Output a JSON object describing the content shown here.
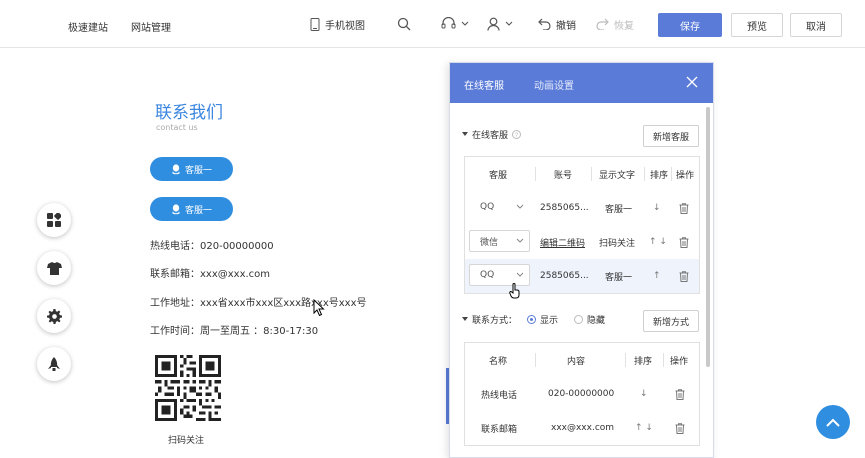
{
  "toolbar": {
    "nav_fast_site": "极速建站",
    "nav_site_manage": "网站管理",
    "mobile_view": "手机视图",
    "undo": "撤销",
    "redo": "恢复",
    "save": "保存",
    "preview": "预览",
    "cancel": "取消"
  },
  "page": {
    "section_title": "联系我们",
    "section_subtitle": "contact us",
    "qq_buttons": [
      "客服一",
      "客服一"
    ],
    "hotline": "热线电话：020-00000000",
    "email": "联系邮箱：xxx@xxx.com",
    "address": "工作地址：xxx省xxx市xxx区xxx路xxx号xxx号",
    "hours": "工作时间：周一至周五 ：8:30-17:30",
    "qr_caption": "扫码关注"
  },
  "panel": {
    "tab_service": "在线客服",
    "tab_animation": "动画设置",
    "group_service": "在线客服",
    "add_service": "新增客服",
    "service_columns": [
      "客服",
      "账号",
      "显示文字",
      "排序",
      "操作"
    ],
    "service_rows": [
      {
        "type": "QQ",
        "account": "2585065...",
        "label": "客服一",
        "sort": "↓"
      },
      {
        "type": "微信",
        "account": "编辑二维码",
        "label": "扫码关注",
        "sort": "↑ ↓"
      },
      {
        "type": "QQ",
        "account": "2585065...",
        "label": "客服一",
        "sort": "↑"
      }
    ],
    "contact_label": "联系方式：",
    "show": "显示",
    "hide": "隐藏",
    "add_contact": "新增方式",
    "contact_columns": [
      "名称",
      "内容",
      "排序",
      "操作"
    ],
    "contact_rows": [
      {
        "name": "热线电话",
        "content": "020-00000000",
        "sort": "↓"
      },
      {
        "name": "联系邮箱",
        "content": "xxx@xxx.com",
        "sort": "↑ ↓"
      }
    ]
  },
  "colors": {
    "accent": "#5a7bd8",
    "button_blue": "#2f8ee0",
    "title_blue": "#3a86e0"
  }
}
